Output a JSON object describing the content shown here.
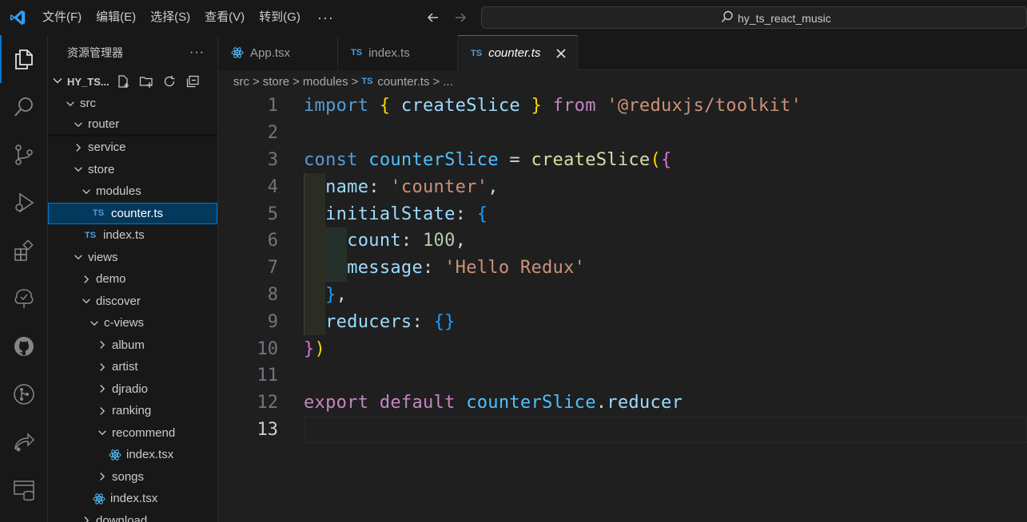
{
  "titlebar": {
    "menu": [
      "文件(F)",
      "编辑(E)",
      "选择(S)",
      "查看(V)",
      "转到(G)"
    ],
    "more": "···",
    "search_text": "hy_ts_react_music"
  },
  "activitybar": {
    "icons": [
      "explorer-icon",
      "search-icon",
      "source-control-icon",
      "run-debug-icon",
      "extensions-icon",
      "tree-icon",
      "github-icon",
      "git-graph-icon",
      "remote-icon",
      "database-icon"
    ]
  },
  "sidebar": {
    "title": "资源管理器",
    "dots": "···",
    "project": "HY_TS...",
    "tree": [
      {
        "label": "src",
        "type": "folder-open",
        "indent": 0
      },
      {
        "label": "router",
        "type": "folder-open",
        "indent": 1
      },
      {
        "label": "service",
        "type": "folder-closed",
        "indent": 1
      },
      {
        "label": "store",
        "type": "folder-open",
        "indent": 1
      },
      {
        "label": "modules",
        "type": "folder-open",
        "indent": 2
      },
      {
        "label": "counter.ts",
        "type": "ts",
        "indent": 3,
        "selected": true
      },
      {
        "label": "index.ts",
        "type": "ts",
        "indent": 2
      },
      {
        "label": "views",
        "type": "folder-open",
        "indent": 1
      },
      {
        "label": "demo",
        "type": "folder-closed",
        "indent": 2
      },
      {
        "label": "discover",
        "type": "folder-open",
        "indent": 2
      },
      {
        "label": "c-views",
        "type": "folder-open",
        "indent": 3
      },
      {
        "label": "album",
        "type": "folder-closed",
        "indent": 4
      },
      {
        "label": "artist",
        "type": "folder-closed",
        "indent": 4
      },
      {
        "label": "djradio",
        "type": "folder-closed",
        "indent": 4
      },
      {
        "label": "ranking",
        "type": "folder-closed",
        "indent": 4
      },
      {
        "label": "recommend",
        "type": "folder-open",
        "indent": 4
      },
      {
        "label": "index.tsx",
        "type": "react",
        "indent": 5
      },
      {
        "label": "songs",
        "type": "folder-closed",
        "indent": 4
      },
      {
        "label": "index.tsx",
        "type": "react",
        "indent": 3
      },
      {
        "label": "download",
        "type": "folder-closed",
        "indent": 2
      }
    ]
  },
  "tabs": [
    {
      "label": "App.tsx",
      "icon": "react",
      "active": false
    },
    {
      "label": "index.ts",
      "icon": "ts",
      "active": false
    },
    {
      "label": "counter.ts",
      "icon": "ts",
      "active": true
    }
  ],
  "tab_badge": "TS",
  "breadcrumb": {
    "parts": [
      "src",
      "store",
      "modules"
    ],
    "file": "counter.ts",
    "tail": "...",
    "sep": ">"
  },
  "editor": {
    "line_numbers": [
      "1",
      "2",
      "3",
      "4",
      "5",
      "6",
      "7",
      "8",
      "9",
      "10",
      "11",
      "12",
      "13"
    ],
    "current_line": "13",
    "lines": [
      [
        [
          "kw",
          "import"
        ],
        [
          "plain",
          " "
        ],
        [
          "p1",
          "{"
        ],
        [
          "plain",
          " "
        ],
        [
          "var",
          "createSlice"
        ],
        [
          "plain",
          " "
        ],
        [
          "p1",
          "}"
        ],
        [
          "plain",
          " "
        ],
        [
          "kw2",
          "from"
        ],
        [
          "plain",
          " "
        ],
        [
          "str",
          "'@reduxjs/toolkit'"
        ]
      ],
      [],
      [
        [
          "kw",
          "const"
        ],
        [
          "plain",
          " "
        ],
        [
          "var2",
          "counterSlice"
        ],
        [
          "plain",
          " = "
        ],
        [
          "fn",
          "createSlice"
        ],
        [
          "p1",
          "("
        ],
        [
          "p2",
          "{"
        ]
      ],
      [
        [
          "plain",
          "  "
        ],
        [
          "var",
          "name"
        ],
        [
          "plain",
          ": "
        ],
        [
          "str",
          "'counter'"
        ],
        [
          "plain",
          ","
        ]
      ],
      [
        [
          "plain",
          "  "
        ],
        [
          "var",
          "initialState"
        ],
        [
          "plain",
          ": "
        ],
        [
          "p3",
          "{"
        ]
      ],
      [
        [
          "plain",
          "    "
        ],
        [
          "var",
          "count"
        ],
        [
          "plain",
          ": "
        ],
        [
          "num",
          "100"
        ],
        [
          "plain",
          ","
        ]
      ],
      [
        [
          "plain",
          "    "
        ],
        [
          "var",
          "message"
        ],
        [
          "plain",
          ": "
        ],
        [
          "str",
          "'Hello Redux'"
        ]
      ],
      [
        [
          "plain",
          "  "
        ],
        [
          "p3",
          "}"
        ],
        [
          "plain",
          ","
        ]
      ],
      [
        [
          "plain",
          "  "
        ],
        [
          "var",
          "reducers"
        ],
        [
          "plain",
          ": "
        ],
        [
          "p3",
          "{}"
        ]
      ],
      [
        [
          "p2",
          "}"
        ],
        [
          "p1",
          ")"
        ]
      ],
      [],
      [
        [
          "kw2",
          "export"
        ],
        [
          "plain",
          " "
        ],
        [
          "kw2",
          "default"
        ],
        [
          "plain",
          " "
        ],
        [
          "var2",
          "counterSlice"
        ],
        [
          "plain",
          "."
        ],
        [
          "var",
          "reducer"
        ]
      ],
      []
    ]
  }
}
